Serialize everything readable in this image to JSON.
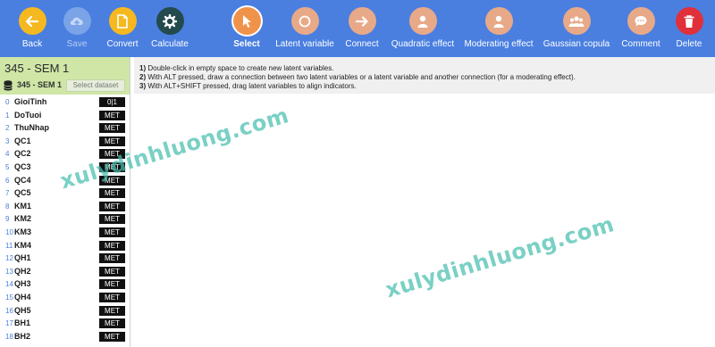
{
  "toolbar": {
    "buttons": [
      {
        "label": "Back",
        "icon": "arrow-left-icon"
      },
      {
        "label": "Save",
        "icon": "cloud-upload-icon"
      },
      {
        "label": "Convert",
        "icon": "document-icon"
      },
      {
        "label": "Calculate",
        "icon": "gear-icon"
      },
      {
        "label": "Select",
        "icon": "cursor-icon"
      },
      {
        "label": "Latent variable",
        "icon": "circle-icon"
      },
      {
        "label": "Connect",
        "icon": "arrow-right-icon"
      },
      {
        "label": "Quadratic effect",
        "icon": "person-icon"
      },
      {
        "label": "Moderating effect",
        "icon": "person-icon"
      },
      {
        "label": "Gaussian copula",
        "icon": "group-icon"
      },
      {
        "label": "Comment",
        "icon": "speech-bubble-icon"
      },
      {
        "label": "Delete",
        "icon": "trash-icon"
      }
    ]
  },
  "sidebar": {
    "title": "345 - SEM 1",
    "dataset_name": "345 - SEM 1",
    "select_dataset_label": "Select dataset",
    "variables": [
      {
        "index": "0",
        "name": "GioiTinh",
        "type": "0|1"
      },
      {
        "index": "1",
        "name": "DoTuoi",
        "type": "MET"
      },
      {
        "index": "2",
        "name": "ThuNhap",
        "type": "MET"
      },
      {
        "index": "3",
        "name": "QC1",
        "type": "MET"
      },
      {
        "index": "4",
        "name": "QC2",
        "type": "MET"
      },
      {
        "index": "5",
        "name": "QC3",
        "type": "MET"
      },
      {
        "index": "6",
        "name": "QC4",
        "type": "MET"
      },
      {
        "index": "7",
        "name": "QC5",
        "type": "MET"
      },
      {
        "index": "8",
        "name": "KM1",
        "type": "MET"
      },
      {
        "index": "9",
        "name": "KM2",
        "type": "MET"
      },
      {
        "index": "10",
        "name": "KM3",
        "type": "MET"
      },
      {
        "index": "11",
        "name": "KM4",
        "type": "MET"
      },
      {
        "index": "12",
        "name": "QH1",
        "type": "MET"
      },
      {
        "index": "13",
        "name": "QH2",
        "type": "MET"
      },
      {
        "index": "14",
        "name": "QH3",
        "type": "MET"
      },
      {
        "index": "15",
        "name": "QH4",
        "type": "MET"
      },
      {
        "index": "16",
        "name": "QH5",
        "type": "MET"
      },
      {
        "index": "17",
        "name": "BH1",
        "type": "MET"
      },
      {
        "index": "18",
        "name": "BH2",
        "type": "MET"
      }
    ]
  },
  "help": {
    "lines": [
      {
        "num": "1)",
        "text": " Double-click in empty space to create new latent variables."
      },
      {
        "num": "2)",
        "text": " With ALT pressed, draw a connection between two latent variables or a latent variable and another connection (for a moderating effect)."
      },
      {
        "num": "3)",
        "text": " With ALT+SHIFT pressed, drag latent variables to align indicators."
      }
    ]
  },
  "watermark": {
    "text": "xulydinhluong.com"
  },
  "colors": {
    "toolbar_bg": "#4a7fe0",
    "sidebar_header": "#cfe6a6",
    "active_tool": "#f0934a"
  }
}
